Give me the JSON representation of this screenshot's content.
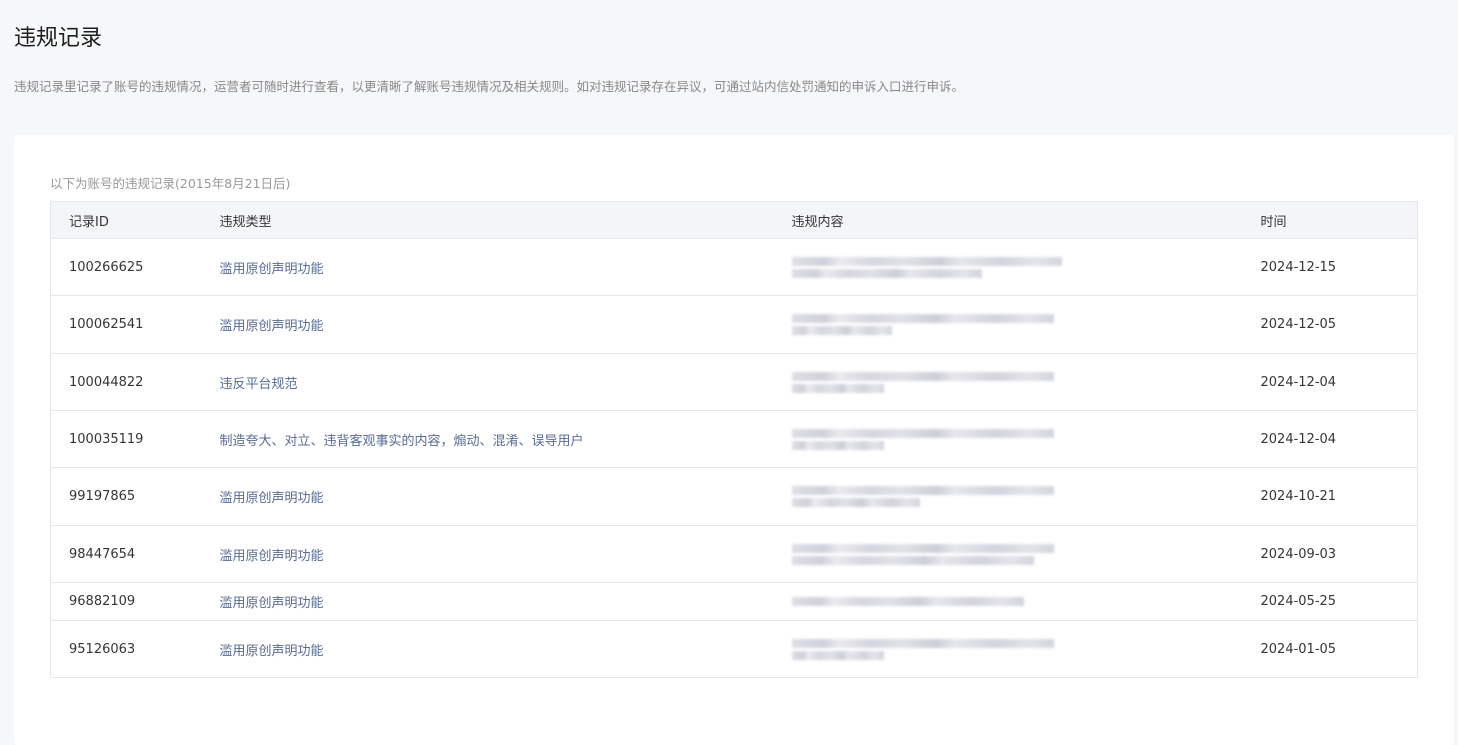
{
  "header": {
    "title": "违规记录",
    "description": "违规记录里记录了账号的违规情况，运营者可随时进行查看，以更清晰了解账号违规情况及相关规则。如对违规记录存在异议，可通过站内信处罚通知的申诉入口进行申诉。"
  },
  "table": {
    "caption": "以下为账号的违规记录(2015年8月21日后)",
    "columns": {
      "id": "记录ID",
      "type": "违规类型",
      "content": "违规内容",
      "time": "时间"
    },
    "rows": [
      {
        "id": "100266625",
        "type": "滥用原创声明功能",
        "time": "2024-12-15"
      },
      {
        "id": "100062541",
        "type": "滥用原创声明功能",
        "time": "2024-12-05"
      },
      {
        "id": "100044822",
        "type": "违反平台规范",
        "time": "2024-12-04"
      },
      {
        "id": "100035119",
        "type": "制造夸大、对立、违背客观事实的内容，煽动、混淆、误导用户",
        "time": "2024-12-04"
      },
      {
        "id": "99197865",
        "type": "滥用原创声明功能",
        "time": "2024-10-21"
      },
      {
        "id": "98447654",
        "type": "滥用原创声明功能",
        "time": "2024-09-03"
      },
      {
        "id": "96882109",
        "type": "滥用原创声明功能",
        "time": "2024-05-25"
      },
      {
        "id": "95126063",
        "type": "滥用原创声明功能",
        "time": "2024-01-05"
      }
    ]
  }
}
